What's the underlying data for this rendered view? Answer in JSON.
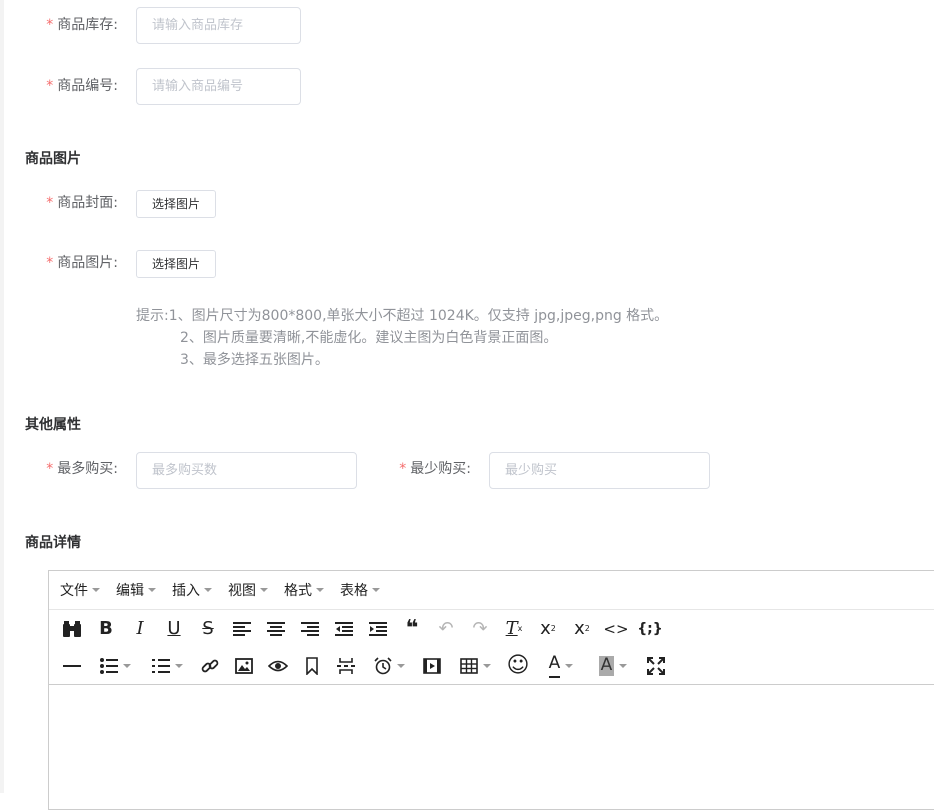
{
  "form": {
    "stock": {
      "label": "商品库存:",
      "placeholder": "请输入商品库存",
      "value": ""
    },
    "code": {
      "label": "商品编号:",
      "placeholder": "请输入商品编号",
      "value": ""
    }
  },
  "images_section": {
    "title": "商品图片",
    "cover": {
      "label": "商品封面:",
      "button": "选择图片"
    },
    "gallery": {
      "label": "商品图片:",
      "button": "选择图片"
    },
    "hint": {
      "line1": "提示:1、图片尺寸为800*800,单张大小不超过 1024K。仅支持 jpg,jpeg,png 格式。",
      "line2": "2、图片质量要清晰,不能虚化。建议主图为白色背景正面图。",
      "line3": "3、最多选择五张图片。"
    }
  },
  "other_section": {
    "title": "其他属性",
    "max_buy": {
      "label": "最多购买:",
      "placeholder": "最多购买数",
      "value": ""
    },
    "min_buy": {
      "label": "最少购买:",
      "placeholder": "最少购买",
      "value": ""
    }
  },
  "detail_section": {
    "title": "商品详情"
  },
  "editor": {
    "menus": [
      {
        "label": "文件"
      },
      {
        "label": "编辑"
      },
      {
        "label": "插入"
      },
      {
        "label": "视图"
      },
      {
        "label": "格式"
      },
      {
        "label": "表格"
      }
    ],
    "glyphs": {
      "bold": "B",
      "italic": "I",
      "underline": "U",
      "strike": "S",
      "blockquote": "❝",
      "undo": "↶",
      "redo": "↷",
      "clear_format": "T",
      "subscript": "x",
      "superscript": "x",
      "code": "<>",
      "code_sample": "{;}",
      "emoticon": "☺",
      "font_color": "A",
      "bg_color": "A"
    },
    "colors": {
      "font_color_bar": "#222222",
      "bg_color_bar": "#aaaaaa"
    }
  },
  "colors": {
    "required": "#f56c6c",
    "border": "#dcdfe6",
    "hint": "#909399"
  }
}
